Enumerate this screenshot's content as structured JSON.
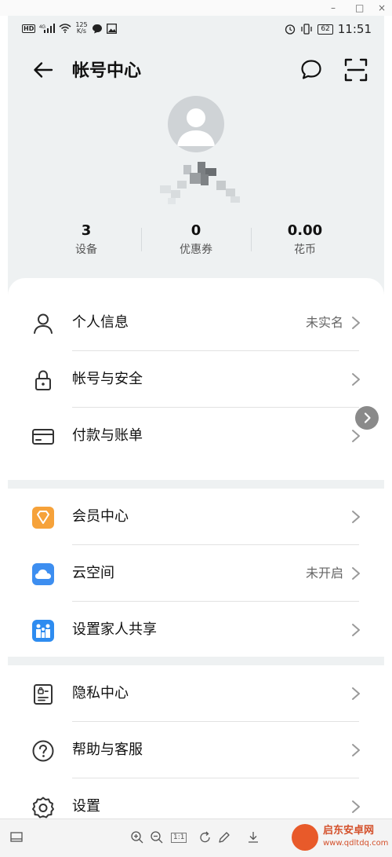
{
  "window": {
    "minimize": "–",
    "maximize": "□",
    "close": "×"
  },
  "status_bar": {
    "network": "HD",
    "signal_label": "⁴ᴳ",
    "speed_value": "125",
    "speed_unit": "K/s",
    "battery": "62",
    "time": "11:51"
  },
  "header": {
    "title": "帐号中心"
  },
  "stats": [
    {
      "value": "3",
      "label": "设备"
    },
    {
      "value": "0",
      "label": "优惠券"
    },
    {
      "value": "0.00",
      "label": "花币"
    }
  ],
  "menu": {
    "personal_info": {
      "label": "个人信息",
      "value": "未实名"
    },
    "account_security": {
      "label": "帐号与安全"
    },
    "payment_bills": {
      "label": "付款与账单"
    },
    "membership": {
      "label": "会员中心"
    },
    "cloud_space": {
      "label": "云空间",
      "value": "未开启"
    },
    "family_sharing": {
      "label": "设置家人共享"
    },
    "privacy_center": {
      "label": "隐私中心"
    },
    "help_service": {
      "label": "帮助与客服"
    },
    "settings": {
      "label": "设置"
    }
  },
  "toolbar": {
    "zoom_label": "1:1"
  },
  "watermark": {
    "name": "启东安卓网",
    "url": "www.qdltdq.com"
  },
  "colors": {
    "background": "#eef1f2",
    "membership_icon": "#f6a23a",
    "cloud_icon": "#3d8ef0",
    "family_icon": "#2e8cf0"
  }
}
